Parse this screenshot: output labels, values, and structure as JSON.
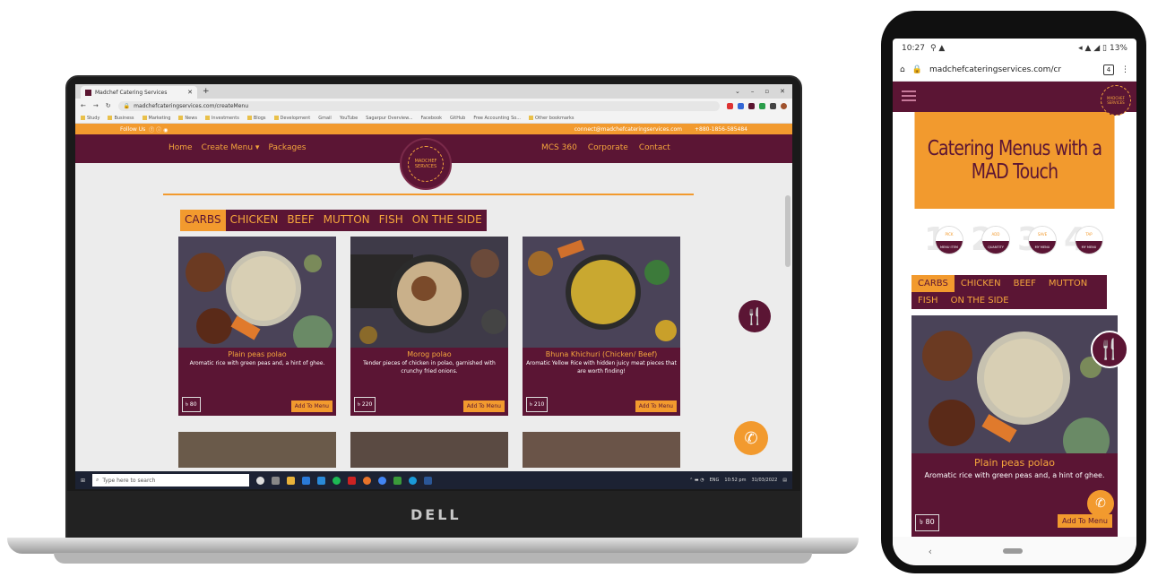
{
  "colors": {
    "maroon": "#5b1534",
    "orange": "#f29a2e",
    "gold_text": "#f5a63c"
  },
  "laptop": {
    "brand": "DELL",
    "browser": {
      "tab_title": "Madchef Catering Services",
      "url": "madchefcateringservices.com/createMenu",
      "bookmarks": [
        "Study",
        "Business",
        "Marketing",
        "News",
        "Investments",
        "Blogs",
        "Development",
        "Gmail",
        "YouTube",
        "Sagarpur Overview...",
        "Facebook",
        "GitHub",
        "Free Accounting So...",
        "Other bookmarks"
      ]
    },
    "site": {
      "topbar_left": "Follow Us",
      "topbar_email": "connect@madchefcateringservices.com",
      "topbar_phone": "+880-1856-585484",
      "nav_left": [
        "Home",
        "Create Menu ▾",
        "Packages"
      ],
      "nav_right": [
        "MCS 360",
        "Corporate",
        "Contact"
      ],
      "logo_text": "MADCHEF SERVICES",
      "categories": [
        "CARBS",
        "CHICKEN",
        "BEEF",
        "MUTTON",
        "FISH",
        "ON THE SIDE"
      ],
      "active_category": "CARBS",
      "cards": [
        {
          "title": "Plain peas polao",
          "desc": "Aromatic rice with green peas and, a hint of ghee.",
          "price": "৳ 80",
          "button": "Add To Menu"
        },
        {
          "title": "Morog polao",
          "desc": "Tender pieces of chicken in polao, garnished with crunchy fried onions.",
          "price": "৳ 220",
          "button": "Add To Menu"
        },
        {
          "title": "Bhuna Khichuri (Chicken/ Beef)",
          "desc": "Aromatic Yellow Rice with hidden juicy meat pieces that are worth finding!",
          "price": "৳ 210",
          "button": "Add To Menu"
        }
      ]
    },
    "taskbar": {
      "search_placeholder": "Type here to search",
      "time": "10:52 pm",
      "date": "31/03/2022",
      "lang": "ENG"
    }
  },
  "phone": {
    "status_time": "10:27",
    "status_right": "13%",
    "url": "madchefcateringservices.com/cr",
    "tab_count": "4",
    "hero_title": "Catering Menus with a MAD Touch",
    "steps": [
      {
        "num": "1",
        "top": "PICK",
        "bottom": "MENU ITEM"
      },
      {
        "num": "2",
        "top": "ADD",
        "bottom": "QUANTITY"
      },
      {
        "num": "3",
        "top": "SAVE",
        "bottom": "MY MENU"
      },
      {
        "num": "4",
        "top": "TAP",
        "bottom": "MY MENU"
      }
    ],
    "categories": [
      "CARBS",
      "CHICKEN",
      "BEEF",
      "MUTTON",
      "FISH",
      "ON THE SIDE"
    ],
    "active_category": "CARBS",
    "card": {
      "title": "Plain peas polao",
      "desc": "Aromatic rice with green peas and, a hint of ghee.",
      "price": "৳ 80",
      "button": "Add To Menu"
    }
  }
}
